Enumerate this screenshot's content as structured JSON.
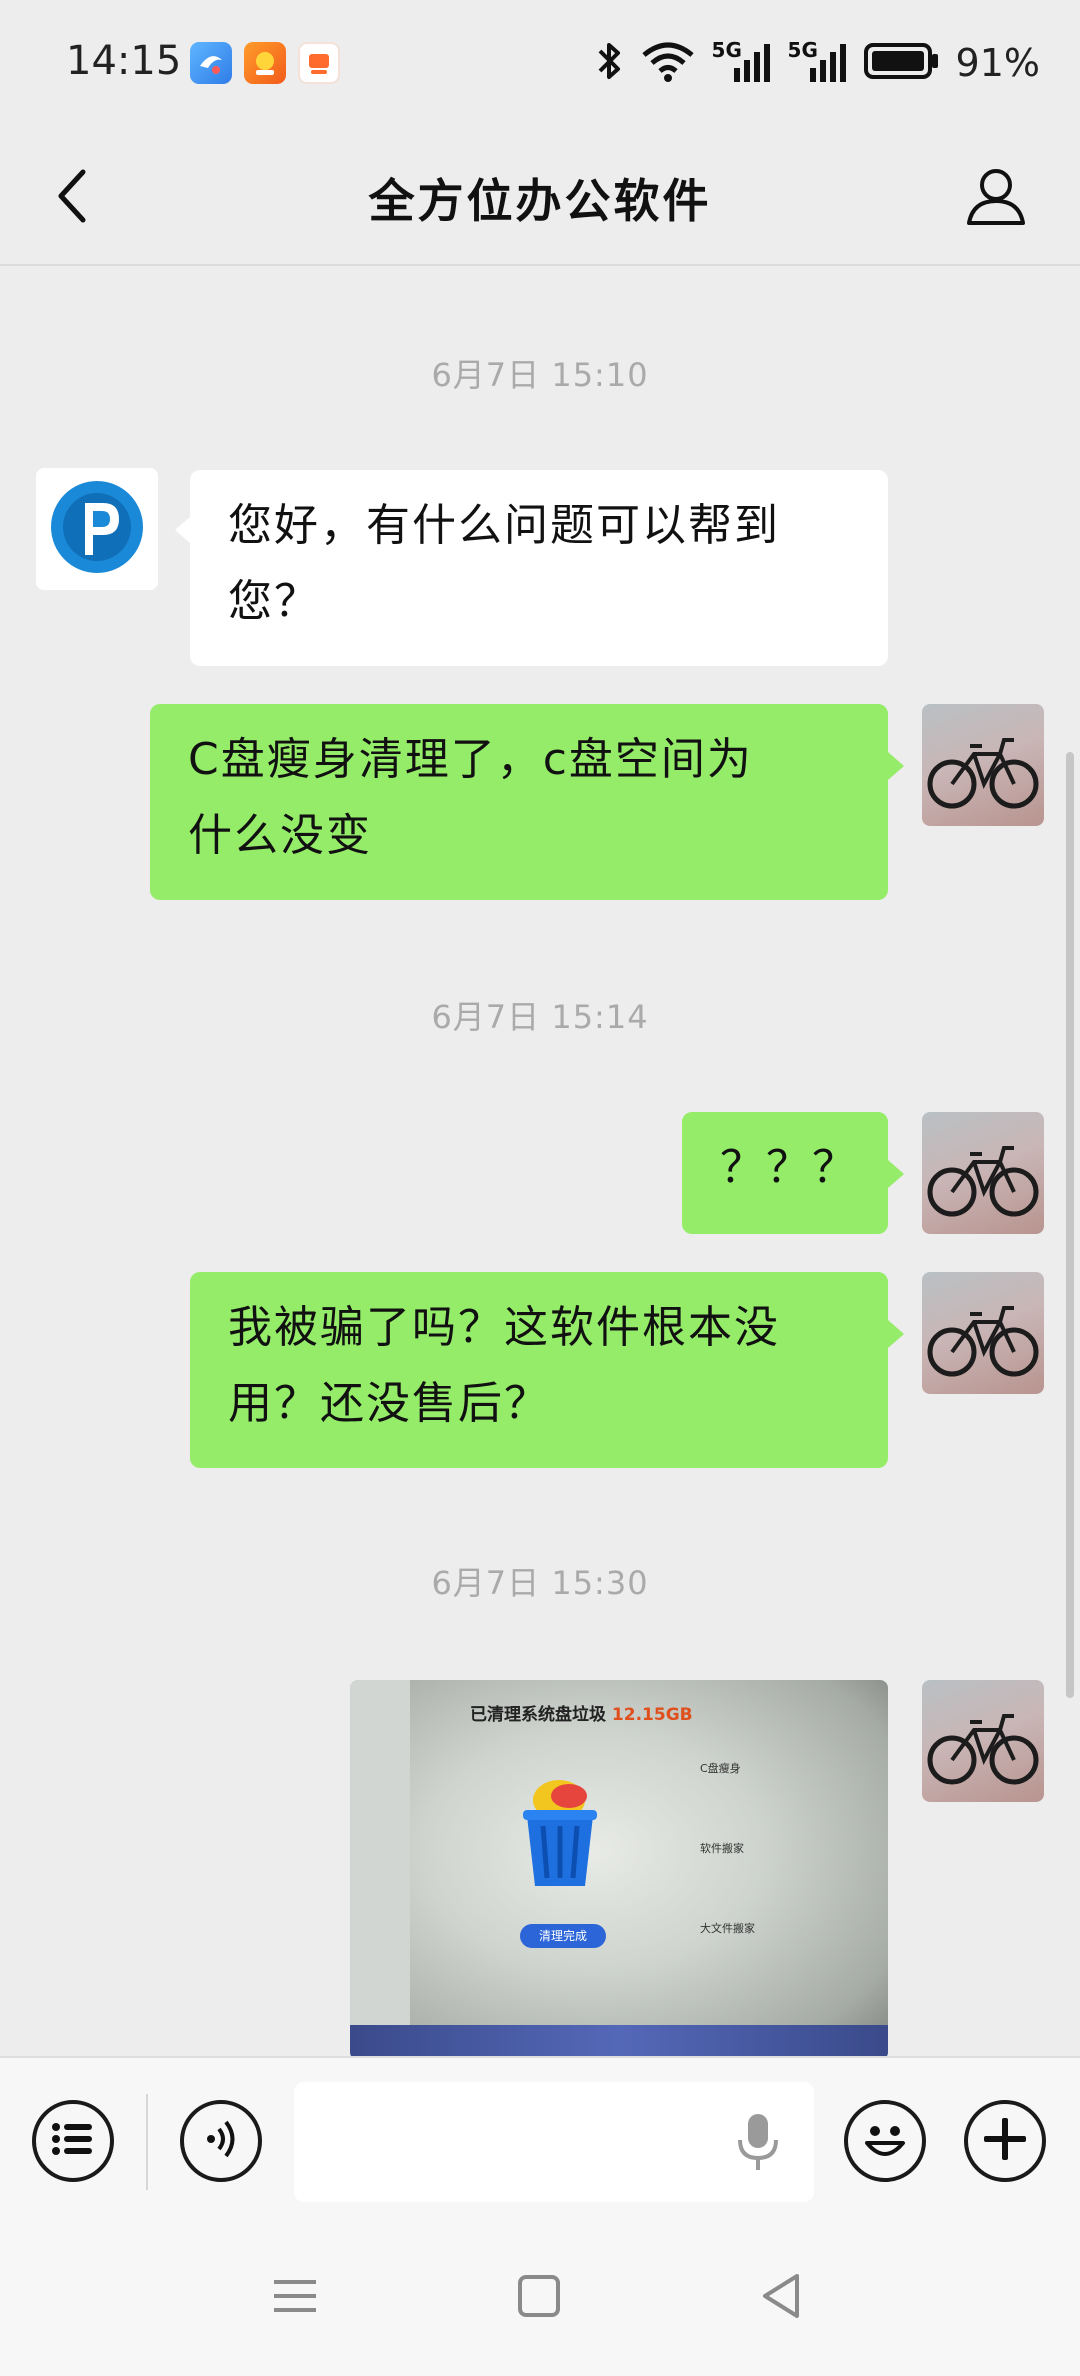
{
  "status_bar": {
    "time": "14:15",
    "battery_text": "91%",
    "app_icons": [
      "app-icon-1",
      "app-icon-2",
      "app-icon-3"
    ],
    "icons": [
      "bluetooth-icon",
      "wifi-icon",
      "5g-signal-icon",
      "5g-signal-icon",
      "battery-icon"
    ],
    "network_label_1": "5G",
    "network_label_2": "5G"
  },
  "header": {
    "title": "全方位办公软件",
    "back_icon": "chevron-left-icon",
    "profile_icon": "person-icon"
  },
  "chat": {
    "messages": [
      {
        "type": "timestamp",
        "text": "6月7日 15:10"
      },
      {
        "type": "text",
        "direction": "incoming",
        "line1": "您好，有什么问题可以帮到",
        "line2": "您？"
      },
      {
        "type": "text",
        "direction": "outgoing",
        "line1": "C盘瘦身清理了，c盘空间为",
        "line2": "什么没变"
      },
      {
        "type": "timestamp",
        "text": "6月7日 15:14"
      },
      {
        "type": "text",
        "direction": "outgoing",
        "text": "？？？"
      },
      {
        "type": "text",
        "direction": "outgoing",
        "line1": "我被骗了吗？这软件根本没",
        "line2": "用？还没售后？"
      },
      {
        "type": "timestamp",
        "text": "6月7日 15:30"
      },
      {
        "type": "image",
        "direction": "outgoing",
        "screen_headline": "已清理系统盘垃圾",
        "screen_amount": "12.15GB",
        "screen_button": "清理完成",
        "screen_section_1": "C盘瘦身",
        "screen_section_2": "软件搬家",
        "screen_section_3": "大文件搬家"
      }
    ]
  },
  "input_bar": {
    "menu_icon": "list-menu-icon",
    "voice_icon": "voice-toggle-icon",
    "input_value": "",
    "mic_icon": "microphone-icon",
    "emoji_icon": "emoji-icon",
    "plus_icon": "plus-icon"
  },
  "nav_bar": {
    "icons": [
      "menu-nav-icon",
      "home-nav-icon",
      "back-nav-icon"
    ]
  },
  "colors": {
    "background": "#ededed",
    "outgoing_bubble": "#95ec69",
    "incoming_bubble": "#ffffff",
    "timestamp": "#aaaaaa",
    "brand_blue": "#1a8ad8"
  }
}
